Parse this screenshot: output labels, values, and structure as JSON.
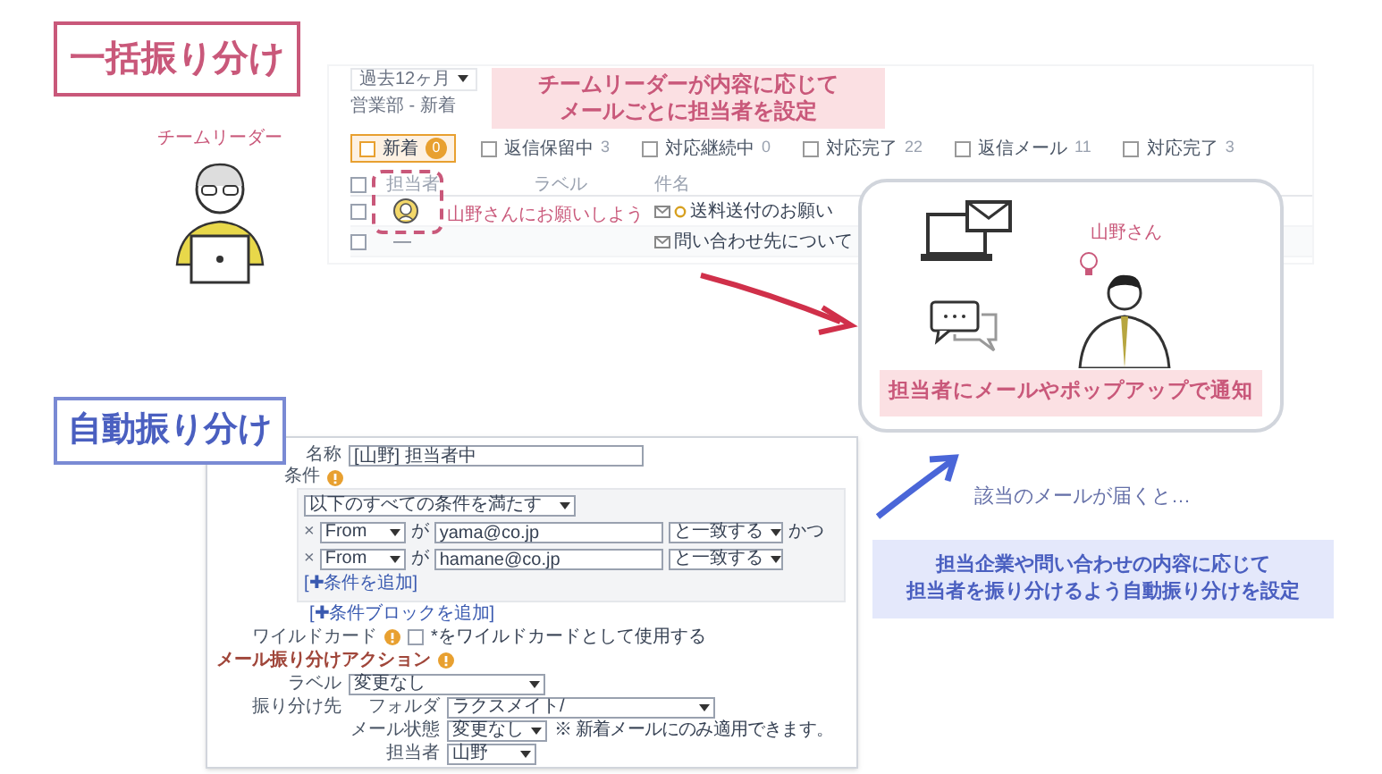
{
  "manual": {
    "heading": "一括振り分け",
    "leader_label": "チームリーダー",
    "callout": [
      "チームリーダーが内容に応じて",
      "メールごとに担当者を設定"
    ],
    "annotation": "山野さんにお願いしよう",
    "mail_list": {
      "period": "過去12ヶ月",
      "folder": "営業部 - 新着",
      "tabs": [
        {
          "label": "新着",
          "count": "0",
          "selected": true
        },
        {
          "label": "返信保留中",
          "count": "3",
          "selected": false
        },
        {
          "label": "対応継続中",
          "count": "0",
          "selected": false
        },
        {
          "label": "対応完了",
          "count": "22",
          "selected": false
        },
        {
          "label": "返信メール",
          "count": "11",
          "selected": false
        },
        {
          "label": "対応完了",
          "count": "3",
          "selected": false
        }
      ],
      "select_all_checked": false,
      "columns": [
        "担当者",
        "ラベル",
        "件名"
      ],
      "rows": [
        {
          "kind": "assigned",
          "checked": false,
          "subject": "送料送付のお願い"
        },
        {
          "kind": "unassigned",
          "checked": false,
          "assignee": "—",
          "subject": "問い合わせ先について"
        }
      ]
    }
  },
  "notification": {
    "person_label": "山野さん",
    "banner": "担当者にメールやポップアップで通知"
  },
  "auto": {
    "heading": "自動振り分け",
    "arrival_note": "該当のメールが届くと…",
    "callout": [
      "担当企業や問い合わせの内容に応じて",
      "担当者を振り分けるよう自動振り分けを設定"
    ],
    "form": {
      "name_label": "名称",
      "name_value": "[山野] 担当者中",
      "condition_label": "条件",
      "match_mode": "以下のすべての条件を満たす",
      "conditions": [
        {
          "remove": "×",
          "field": "From",
          "particle": "が",
          "value": "yama@co.jp",
          "operator": "と一致する",
          "joiner": "かつ"
        },
        {
          "remove": "×",
          "field": "From",
          "particle": "が",
          "value": "hamane@co.jp",
          "operator": "と一致する"
        }
      ],
      "add_condition": "[✚条件を追加]",
      "add_block": "[✚条件ブロックを追加]",
      "wildcard_label": "ワイルドカード",
      "wildcard_option": "*をワイルドカードとして使用する",
      "wildcard_checked": false,
      "action_heading": "メール振り分けアクション",
      "label_label": "ラベル",
      "label_value": "変更なし",
      "dest_label": "振り分け先",
      "folder_label": "フォルダ",
      "folder_value": "ラクスメイト/",
      "state_label": "メール状態",
      "state_value": "変更なし",
      "state_note": "※ 新着メールにのみ適用できます。",
      "assignee_label": "担当者",
      "assignee_value": "山野"
    }
  }
}
